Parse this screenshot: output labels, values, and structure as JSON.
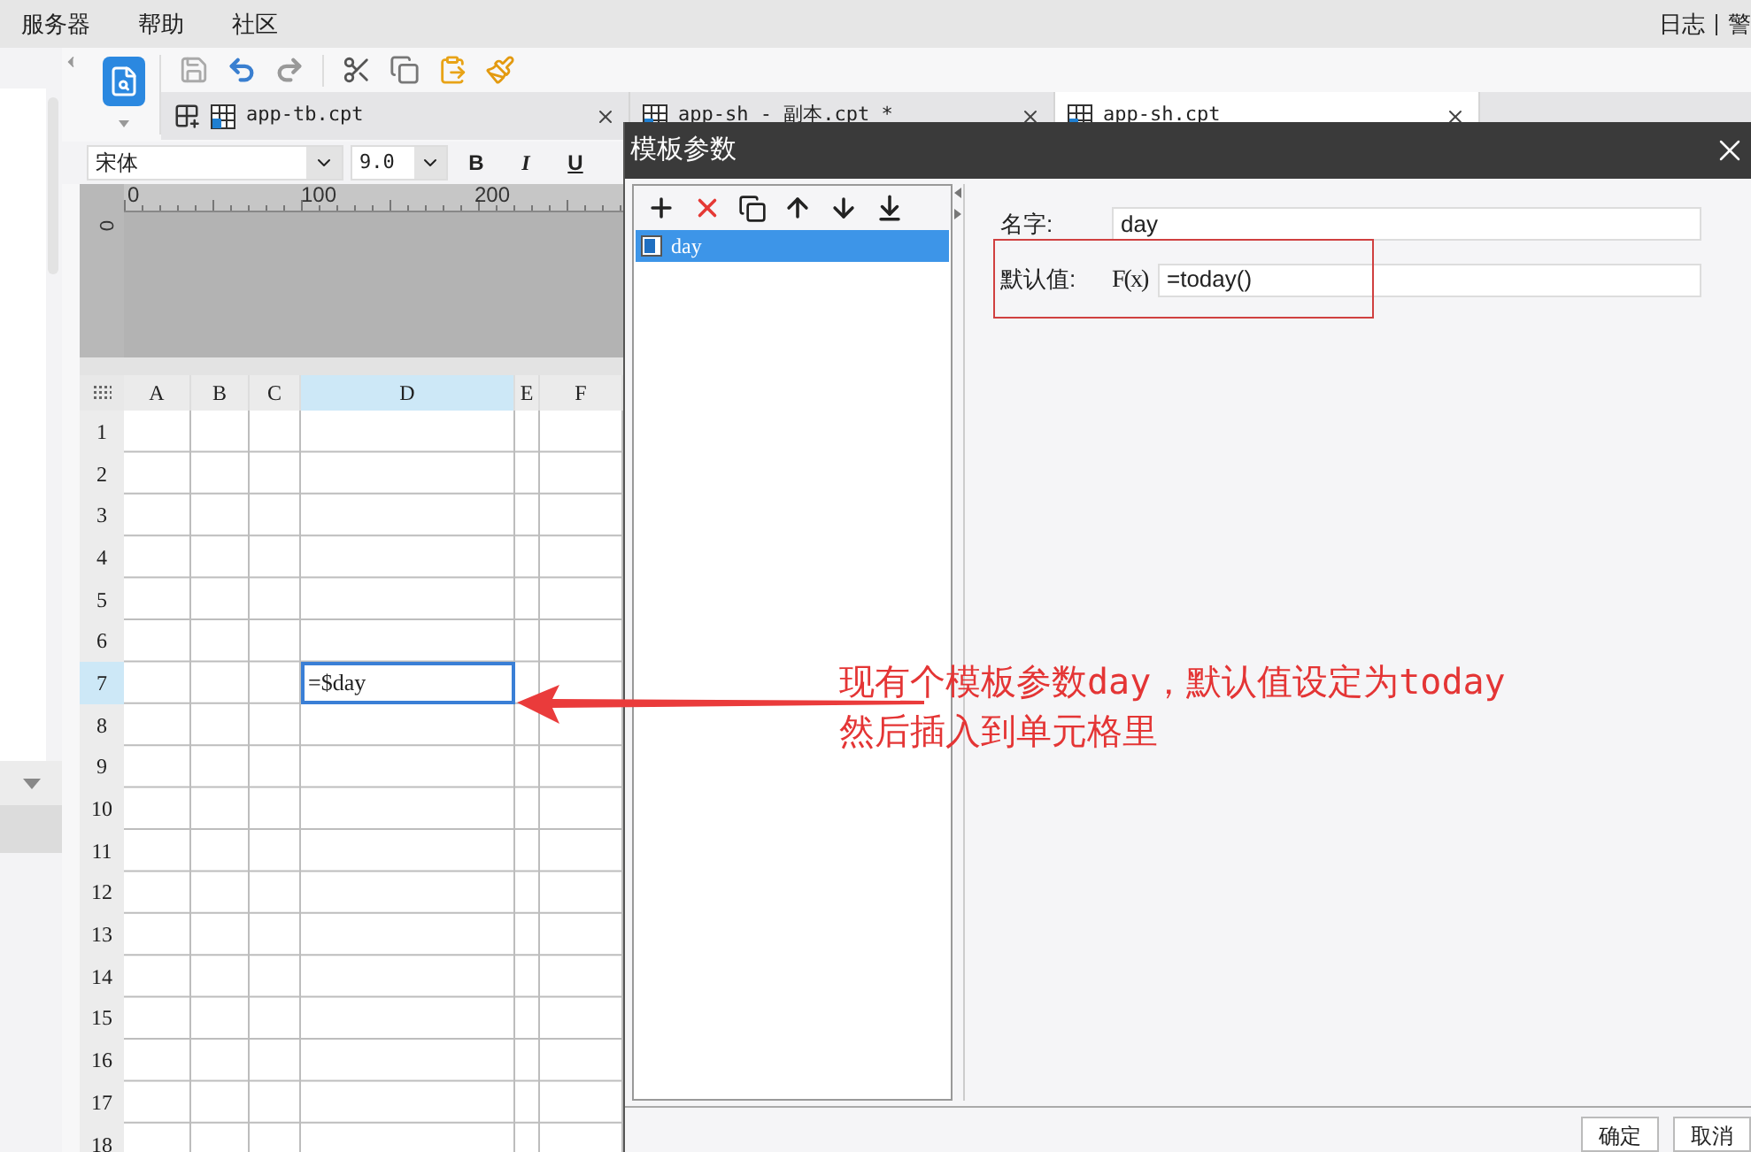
{
  "menu": {
    "items": [
      "服务器",
      "帮助",
      "社区"
    ],
    "right": [
      "日志",
      "警"
    ]
  },
  "tabs": [
    {
      "label": "app-tb.cpt",
      "selected": false
    },
    {
      "label": "app-sh - 副本.cpt *",
      "selected": false
    },
    {
      "label": "app-sh.cpt",
      "selected": true
    }
  ],
  "format_bar": {
    "font": "宋体",
    "size": "9.0",
    "buttons": [
      "B",
      "I",
      "U"
    ]
  },
  "ruler": {
    "ticks": [
      "0",
      "100",
      "200"
    ],
    "vertical": "0"
  },
  "sheet": {
    "columns": [
      {
        "label": "A",
        "selected": false
      },
      {
        "label": "B",
        "selected": false
      },
      {
        "label": "C",
        "selected": false
      },
      {
        "label": "D",
        "selected": true
      },
      {
        "label": "E",
        "selected": false
      },
      {
        "label": "F",
        "selected": false
      }
    ],
    "rows": [
      {
        "label": "1",
        "selected": false
      },
      {
        "label": "2",
        "selected": false
      },
      {
        "label": "3",
        "selected": false
      },
      {
        "label": "4",
        "selected": false
      },
      {
        "label": "5",
        "selected": false
      },
      {
        "label": "6",
        "selected": false
      },
      {
        "label": "7",
        "selected": true,
        "cell_d": "=$day"
      },
      {
        "label": "8",
        "selected": false
      },
      {
        "label": "9",
        "selected": false
      },
      {
        "label": "10",
        "selected": false
      },
      {
        "label": "11",
        "selected": false
      },
      {
        "label": "12",
        "selected": false
      },
      {
        "label": "13",
        "selected": false
      },
      {
        "label": "14",
        "selected": false
      },
      {
        "label": "15",
        "selected": false
      },
      {
        "label": "16",
        "selected": false
      },
      {
        "label": "17",
        "selected": false
      },
      {
        "label": "18",
        "selected": false
      }
    ]
  },
  "dialog": {
    "title": "模板参数",
    "parameters": [
      {
        "name": "day",
        "selected": true
      }
    ],
    "fields": [
      {
        "kind": "text",
        "label": "名字:",
        "value": "day"
      },
      {
        "kind": "formula",
        "label": "默认值:",
        "button": "F(x)",
        "value": "=today()"
      }
    ],
    "buttons": [
      "确定",
      "取消"
    ]
  },
  "annotation": {
    "lines": [
      "现有个模板参数day，默认值设定为today",
      "然后插入到单元格里"
    ]
  }
}
